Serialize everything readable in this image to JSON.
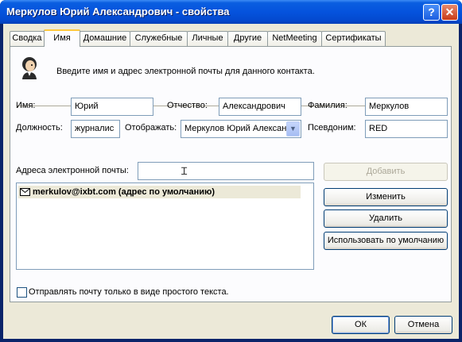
{
  "window": {
    "title": "Меркулов Юрий Александрович - свойства",
    "help_symbol": "?",
    "close_symbol": "✕"
  },
  "tabs": [
    "Сводка",
    "Имя",
    "Домашние",
    "Служебные",
    "Личные",
    "Другие",
    "NetMeeting",
    "Сертификаты"
  ],
  "active_tab": "Имя",
  "intro": {
    "text": "Введите имя и адрес электронной почты для данного контакта.",
    "icon": "person-icon"
  },
  "fields": {
    "first_name_label": "Имя:",
    "first_name_value": "Юрий",
    "middle_name_label": "Отчество:",
    "middle_name_value": "Александрович",
    "last_name_label": "Фамилия:",
    "last_name_value": "Меркулов",
    "title_label": "Должность:",
    "title_value": "журналис",
    "display_label": "Отображать:",
    "display_value": "Меркулов Юрий Алексан",
    "nickname_label": "Псевдоним:",
    "nickname_value": "RED"
  },
  "email": {
    "label": "Адреса электронной почты:",
    "input_value": "",
    "entries": [
      {
        "text": "merkulov@ixbt.com  (адрес по умолчанию)",
        "icon": "mail-icon"
      }
    ]
  },
  "buttons": {
    "add": "Добавить",
    "edit": "Изменить",
    "delete": "Удалить",
    "set_default": "Использовать по умолчанию",
    "ok": "ОК",
    "cancel": "Отмена"
  },
  "plain_text_checkbox": {
    "label": "Отправлять почту только в виде простого текста.",
    "checked": false
  }
}
